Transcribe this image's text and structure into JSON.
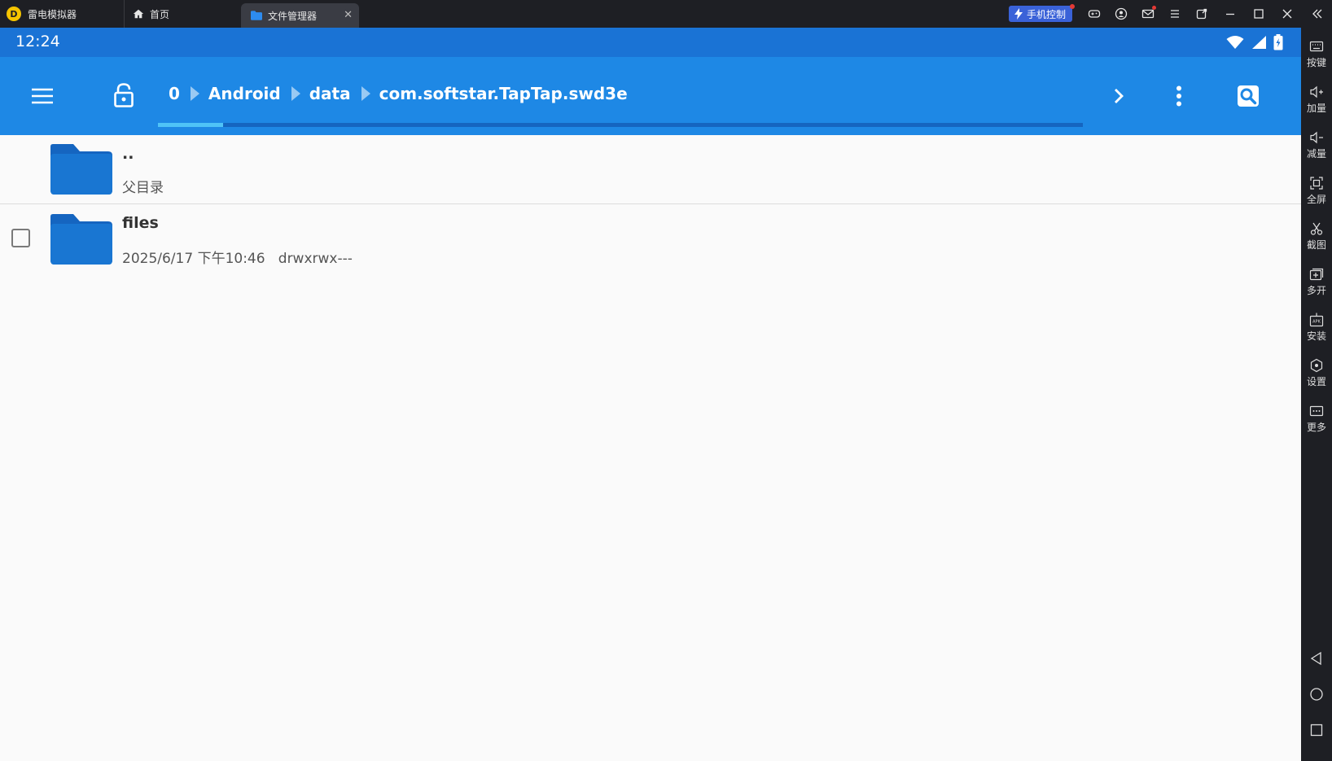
{
  "emulator": {
    "app_name": "雷电模拟器",
    "tabs": [
      {
        "label": "首页",
        "icon": "home-icon"
      },
      {
        "label": "文件管理器",
        "icon": "folder-icon"
      }
    ],
    "phone_control_label": "手机控制",
    "window_controls": [
      "gamepad-icon",
      "account-icon",
      "mail-icon",
      "menu-icon",
      "restore-window-icon",
      "minimize-icon",
      "maximize-icon",
      "close-icon",
      "collapse-sidebar-icon"
    ]
  },
  "statusbar": {
    "time": "12:24",
    "icons": [
      "wifi-icon",
      "signal-icon",
      "battery-icon"
    ]
  },
  "toolbar": {
    "breadcrumb": [
      "0",
      "Android",
      "data",
      "com.softstar.TapTap.swd3e"
    ],
    "progress": 0.07,
    "icons": [
      "hamburger-menu-icon",
      "unlock-icon",
      "chevron-right-icon",
      "more-vert-icon",
      "search-icon"
    ]
  },
  "files": [
    {
      "name": "..",
      "subtitle": "父目录"
    },
    {
      "name": "files",
      "date": "2025/6/17 下午10:46",
      "permissions": "drwxrwx---"
    }
  ],
  "sidebar": {
    "items": [
      {
        "label": "按键",
        "icon": "keyboard-icon"
      },
      {
        "label": "加量",
        "icon": "volume-up-icon"
      },
      {
        "label": "减量",
        "icon": "volume-down-icon"
      },
      {
        "label": "全屏",
        "icon": "fullscreen-icon"
      },
      {
        "label": "截图",
        "icon": "scissors-icon"
      },
      {
        "label": "多开",
        "icon": "multi-instance-icon"
      },
      {
        "label": "安装",
        "icon": "apk-install-icon"
      },
      {
        "label": "设置",
        "icon": "settings-icon"
      },
      {
        "label": "更多",
        "icon": "more-icon"
      }
    ],
    "nav": [
      "back-icon",
      "home-circle-icon",
      "recents-icon"
    ]
  },
  "colors": {
    "titlebar": "#1e1f24",
    "statusbar": "#1a73d5",
    "toolbar": "#1e88e5",
    "folder": "#1976d2",
    "progress_fill": "#4fc3f7"
  }
}
